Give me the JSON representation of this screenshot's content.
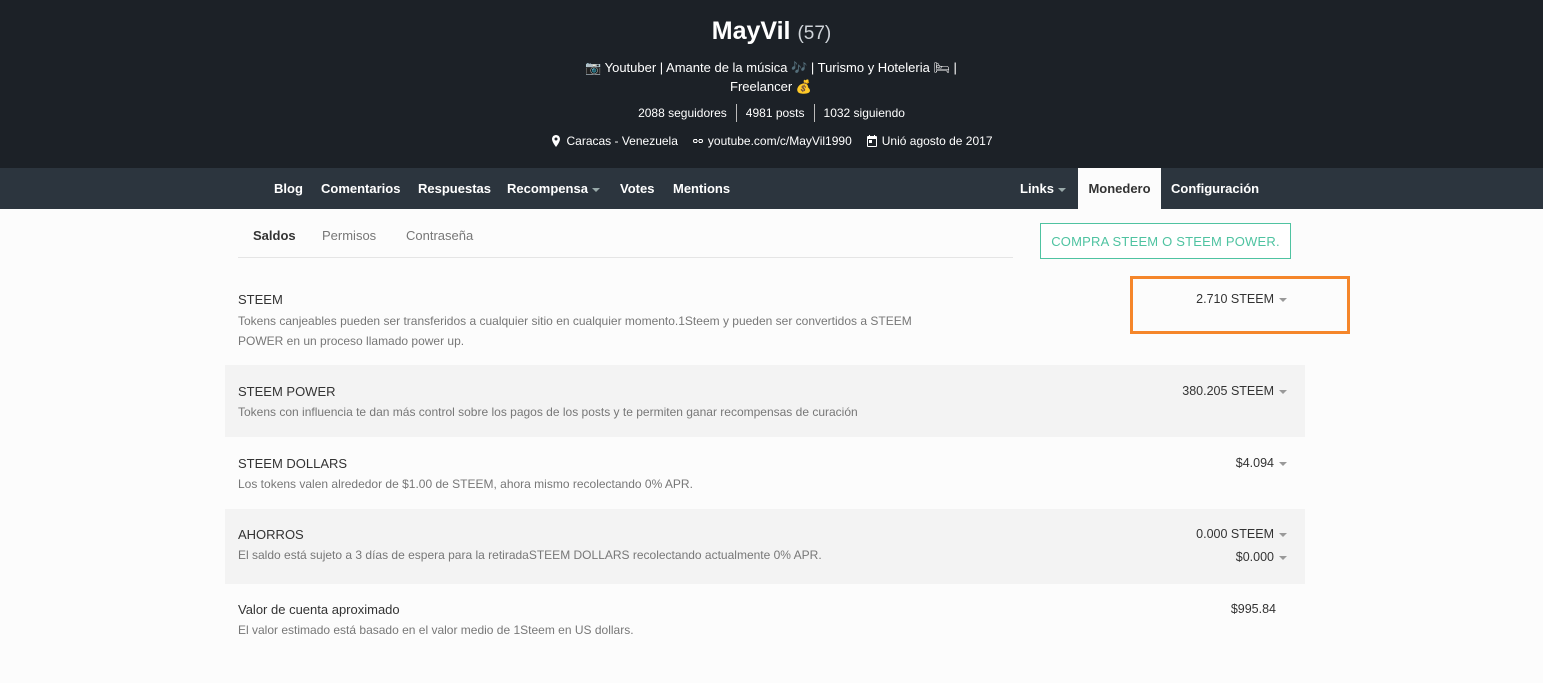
{
  "profile": {
    "name": "MayVil",
    "reputation": "(57)",
    "about_line1": "📷 Youtuber | Amante de la música 🎶 | Turismo y Hoteleria 🛏 |",
    "about_line2": "Freelancer 💰",
    "stats": {
      "followers": "2088 seguidores",
      "posts": "4981 posts",
      "following": "1032 siguiendo"
    },
    "location": "Caracas - Venezuela",
    "website": "youtube.com/c/MayVil1990",
    "joined": "Unió agosto de 2017"
  },
  "nav": {
    "blog": "Blog",
    "comments": "Comentarios",
    "replies": "Respuestas",
    "rewards": "Recompensa",
    "votes": "Votes",
    "mentions": "Mentions",
    "links": "Links",
    "wallet": "Monedero",
    "settings": "Configuración"
  },
  "subtabs": {
    "balances": "Saldos",
    "permissions": "Permisos",
    "password": "Contraseña"
  },
  "buy_button": "COMPRA STEEM O STEEM POWER.",
  "balances": {
    "steem": {
      "title": "STEEM",
      "desc_line1": "Tokens canjeables pueden ser transferidos a cualquier sitio en cualquier momento.1Steem y pueden ser convertidos a STEEM",
      "desc_line2": "POWER en un proceso llamado power up.",
      "value": "2.710 STEEM"
    },
    "steem_power": {
      "title": "STEEM POWER",
      "desc": "Tokens con influencia te dan más control sobre los pagos de los posts y te permiten ganar recompensas de curación",
      "value": "380.205 STEEM"
    },
    "steem_dollars": {
      "title": "STEEM DOLLARS",
      "desc": "Los tokens valen alrededor de $1.00 de STEEM, ahora mismo recolectando 0% APR.",
      "value": "$4.094"
    },
    "savings": {
      "title": "AHORROS",
      "desc": "El saldo está sujeto a 3 días de espera para la retiradaSTEEM DOLLARS recolectando actualmente 0% APR.",
      "value_steem": "0.000 STEEM",
      "value_sbd": "$0.000"
    },
    "account_value": {
      "title": "Valor de cuenta aproximado",
      "desc": "El valor estimado está basado en el valor medio de 1Steem en US dollars.",
      "value": "$995.84"
    }
  },
  "colors": {
    "header_bg": "#1c2127",
    "nav_bg": "#2c353e",
    "accent": "#4fc3a1",
    "highlight": "#f5862a"
  }
}
